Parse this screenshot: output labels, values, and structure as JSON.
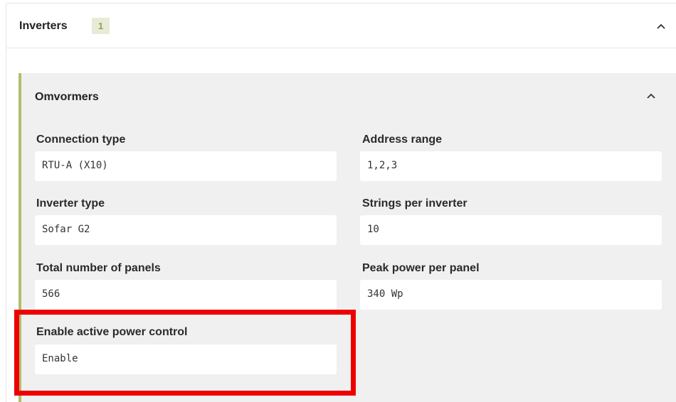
{
  "outer_panel": {
    "title": "Inverters",
    "badge_count": "1"
  },
  "inner_panel": {
    "title": "Omvormers",
    "fields": {
      "connection_type": {
        "label": "Connection type",
        "value": "RTU-A (X10)"
      },
      "address_range": {
        "label": "Address range",
        "value": "1,2,3"
      },
      "inverter_type": {
        "label": "Inverter type",
        "value": "Sofar G2"
      },
      "strings_per_inverter": {
        "label": "Strings per inverter",
        "value": "10"
      },
      "total_panels": {
        "label": "Total number of panels",
        "value": "566"
      },
      "peak_power": {
        "label": "Peak power per panel",
        "value": "340 Wp"
      },
      "active_power_control": {
        "label": "Enable active power control",
        "value": "Enable"
      }
    }
  },
  "colors": {
    "accent_border": "#b3bd6e",
    "badge_bg": "#e8ecd6",
    "badge_text": "#8fa052",
    "highlight": "#ee0000",
    "inner_bg": "#f0f0f0"
  },
  "icons": {
    "collapse_outer": "chevron-up-icon",
    "collapse_inner": "chevron-up-icon"
  }
}
